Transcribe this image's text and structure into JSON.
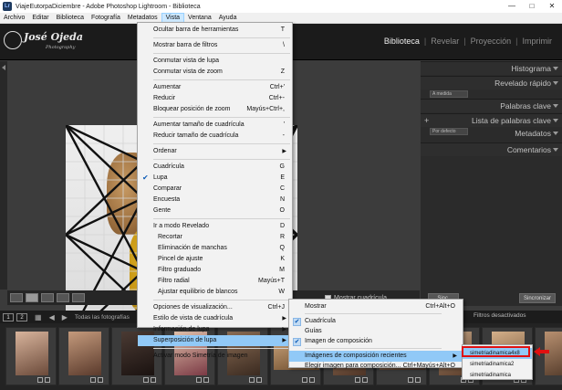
{
  "window": {
    "title": "ViajeEutorpaDiciembre - Adobe Photoshop Lightroom - Biblioteca",
    "app_icon": "Lr"
  },
  "menubar": [
    "Archivo",
    "Editar",
    "Biblioteca",
    "Fotografía",
    "Metadatos",
    "Vista",
    "Ventana",
    "Ayuda"
  ],
  "menubar_active": "Vista",
  "identity": {
    "name": "José Ojeda",
    "sub": "Photography"
  },
  "modules": [
    {
      "label": "Biblioteca",
      "active": true
    },
    {
      "label": "Revelar",
      "active": false
    },
    {
      "label": "Proyección",
      "active": false
    },
    {
      "label": "Imprimir",
      "active": false
    }
  ],
  "right_panel": {
    "histogram": "Histograma",
    "quick_dev": "Revelado rápido",
    "quick_dev_preset": "A medida",
    "keywords": "Palabras clave",
    "keyword_list": "Lista de palabras clave",
    "metadata": "Metadatos",
    "metadata_preset": "Por defecto",
    "comments": "Comentarios",
    "sync": "Sinc.",
    "sync_settings": "Sincronizar"
  },
  "toolbar": {
    "overlay_label": "Mostrar cuadrícula"
  },
  "filmstrip_nav": {
    "page1": "1",
    "page2": "2",
    "source": "Todas las fotografías",
    "filter_label": "Filtro :",
    "filter_value": "Filtros desactivados"
  },
  "vista_menu": [
    {
      "label": "Ocultar barra de herramientas",
      "shortcut": "T"
    },
    {
      "sep": true
    },
    {
      "label": "Mostrar barra de filtros",
      "shortcut": "\\"
    },
    {
      "sep": true
    },
    {
      "label": "Conmutar vista de lupa",
      "shortcut": ""
    },
    {
      "label": "Conmutar vista de zoom",
      "shortcut": "Z"
    },
    {
      "sep": true
    },
    {
      "label": "Aumentar",
      "shortcut": "Ctrl+'"
    },
    {
      "label": "Reducir",
      "shortcut": "Ctrl+-"
    },
    {
      "label": "Bloquear posición de zoom",
      "shortcut": "Mayús+Ctrl+,"
    },
    {
      "sep": true
    },
    {
      "label": "Aumentar tamaño de cuadrícula",
      "shortcut": "'"
    },
    {
      "label": "Reducir tamaño de cuadrícula",
      "shortcut": "-"
    },
    {
      "sep": true
    },
    {
      "label": "Ordenar",
      "submenu": true
    },
    {
      "sep": true
    },
    {
      "label": "Cuadrícula",
      "shortcut": "G"
    },
    {
      "label": "Lupa",
      "shortcut": "E",
      "checked": true
    },
    {
      "label": "Comparar",
      "shortcut": "C"
    },
    {
      "label": "Encuesta",
      "shortcut": "N"
    },
    {
      "label": "Gente",
      "shortcut": "O"
    },
    {
      "sep": true
    },
    {
      "label": "Ir a modo Revelado",
      "shortcut": "D"
    },
    {
      "label": "Recortar",
      "shortcut": "R",
      "indent": true
    },
    {
      "label": "Eliminación de manchas",
      "shortcut": "Q",
      "indent": true
    },
    {
      "label": "Pincel de ajuste",
      "shortcut": "K",
      "indent": true
    },
    {
      "label": "Filtro graduado",
      "shortcut": "M",
      "indent": true
    },
    {
      "label": "Filtro radial",
      "shortcut": "Mayús+T",
      "indent": true
    },
    {
      "label": "Ajustar equilibrio de blancos",
      "shortcut": "W",
      "indent": true
    },
    {
      "sep": true
    },
    {
      "label": "Opciones de visualización...",
      "shortcut": "Ctrl+J"
    },
    {
      "label": "Estilo de vista de cuadrícula",
      "submenu": true
    },
    {
      "label": "Información de lupa",
      "submenu": true
    },
    {
      "label": "Superposición de lupa",
      "submenu": true,
      "highlighted": true
    },
    {
      "sep": true
    },
    {
      "label": "Activar modo Simetría de imagen",
      "shortcut": ""
    }
  ],
  "overlay_menu": [
    {
      "label": "Mostrar",
      "shortcut": "Ctrl+Alt+O",
      "box": false
    },
    {
      "sep": true
    },
    {
      "label": "Cuadrícula",
      "shortcut": "",
      "box": true
    },
    {
      "label": "Guías",
      "shortcut": "",
      "box": false
    },
    {
      "label": "Imagen de composición",
      "shortcut": "",
      "box": true
    },
    {
      "sep": true
    },
    {
      "label": "Imágenes de composición recientes",
      "submenu": true,
      "highlighted": true
    },
    {
      "label": "Elegir imagen para composición...",
      "shortcut": "Ctrl+Mayús+Alt+O"
    }
  ],
  "recent_menu": [
    "simetriadinamica4x8",
    "simetriadinamica2",
    "simetriadinamica"
  ],
  "colors": {
    "menu_highlight": "#91c9f7",
    "callout_red": "#e01010",
    "active_module": "#f0f0f0"
  }
}
